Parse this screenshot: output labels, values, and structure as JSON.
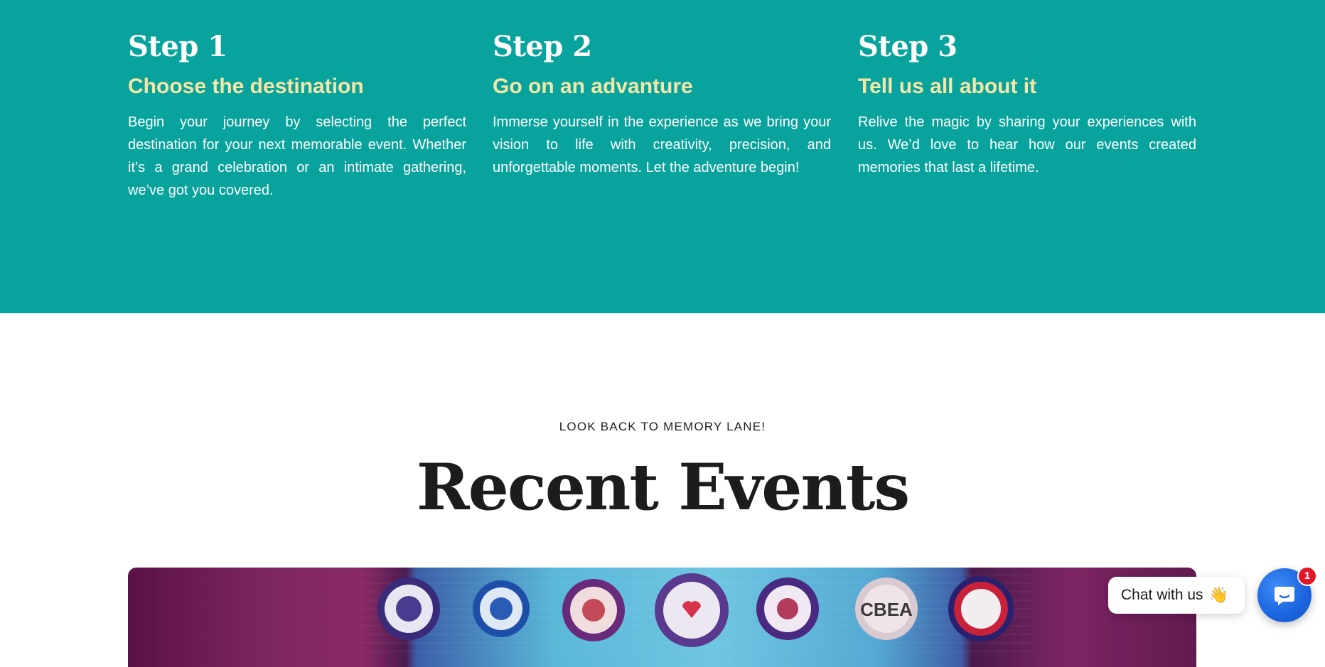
{
  "steps": [
    {
      "number": "Step 1",
      "title": "Choose the destination",
      "body": "Begin your journey by selecting the perfect destination for your next memorable event. Whether it’s a grand celebration or an intimate gathering, we’ve got you covered."
    },
    {
      "number": "Step 2",
      "title": "Go on an advanture",
      "body": "Immerse yourself in the experience as we bring your vision to life with creativity, precision, and unforgettable moments. Let the adventure begin!"
    },
    {
      "number": "Step 3",
      "title": "Tell us all about it",
      "body": "Relive the magic by sharing your experiences with us. We’d love to hear how our events created memories that last a lifetime."
    }
  ],
  "recent": {
    "eyebrow": "LOOK BACK TO MEMORY LANE!",
    "title": "Recent Events",
    "image_emblem_text": "CBEA"
  },
  "chat": {
    "label": "Chat with us",
    "wave_emoji": "👋",
    "badge_count": "1"
  },
  "colors": {
    "teal_band": "#08a39c",
    "step_subtitle": "#f5e6a8",
    "chat_blue": "#1a64de",
    "badge_red": "#e0162b"
  }
}
